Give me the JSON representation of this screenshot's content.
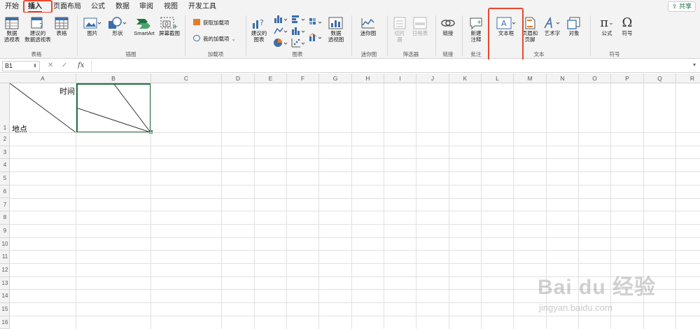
{
  "tabs": [
    {
      "label": "开始",
      "active": false
    },
    {
      "label": "插入",
      "active": true
    },
    {
      "label": "页面布局",
      "active": false
    },
    {
      "label": "公式",
      "active": false
    },
    {
      "label": "数据",
      "active": false
    },
    {
      "label": "审阅",
      "active": false
    },
    {
      "label": "视图",
      "active": false
    },
    {
      "label": "开发工具",
      "active": false
    }
  ],
  "share_label": "共享",
  "ribbon": {
    "tables": {
      "group_label": "表格",
      "pivot": "数据\n透视表",
      "rec_pivot": "建议的\n数据透视表",
      "table": "表格"
    },
    "illustrations": {
      "group_label": "插图",
      "picture": "图片",
      "shape": "形状",
      "smartart": "SmartArt",
      "screenshot": "屏幕截图"
    },
    "addins": {
      "group_label": "加载项",
      "get": "获取加载项",
      "mine": "我的加载项"
    },
    "charts": {
      "group_label": "图表",
      "recommended": "建议的\n图表",
      "pivot_chart": "数据\n透视图"
    },
    "sparklines": {
      "group_label": "迷你图",
      "sparkline": "迷你图"
    },
    "filters": {
      "group_label": "筛选器",
      "slicer": "切片\n器",
      "timeline": "日程表"
    },
    "links": {
      "group_label": "链接",
      "link": "链接"
    },
    "comments": {
      "group_label": "批注",
      "new_comment": "新建\n注释"
    },
    "text": {
      "group_label": "文本",
      "textbox": "文本框",
      "header_footer": "页眉和\n页脚",
      "wordart": "艺术字",
      "object": "对象"
    },
    "symbols": {
      "group_label": "符号",
      "equation": "公式",
      "symbol": "符号"
    }
  },
  "formula_bar": {
    "name_box": "B1",
    "fx": "fx",
    "cancel": "✕",
    "enter": "✓"
  },
  "columns": [
    "A",
    "B",
    "C",
    "D",
    "E",
    "F",
    "G",
    "H",
    "I",
    "J",
    "K",
    "L",
    "M",
    "N",
    "O",
    "P",
    "Q",
    "R"
  ],
  "rows": [
    "1",
    "2",
    "3",
    "4",
    "5",
    "6",
    "7",
    "8",
    "9",
    "10",
    "11",
    "12",
    "13",
    "14",
    "15",
    "16"
  ],
  "cells": {
    "a1_top": "时间",
    "a1_bottom": "地点"
  },
  "watermark": {
    "main": "Bai du 经验",
    "sub": "jingyan.baidu.com"
  },
  "colors": {
    "accent": "#1e7145",
    "highlight": "#e8492f",
    "selection": "#217346"
  }
}
